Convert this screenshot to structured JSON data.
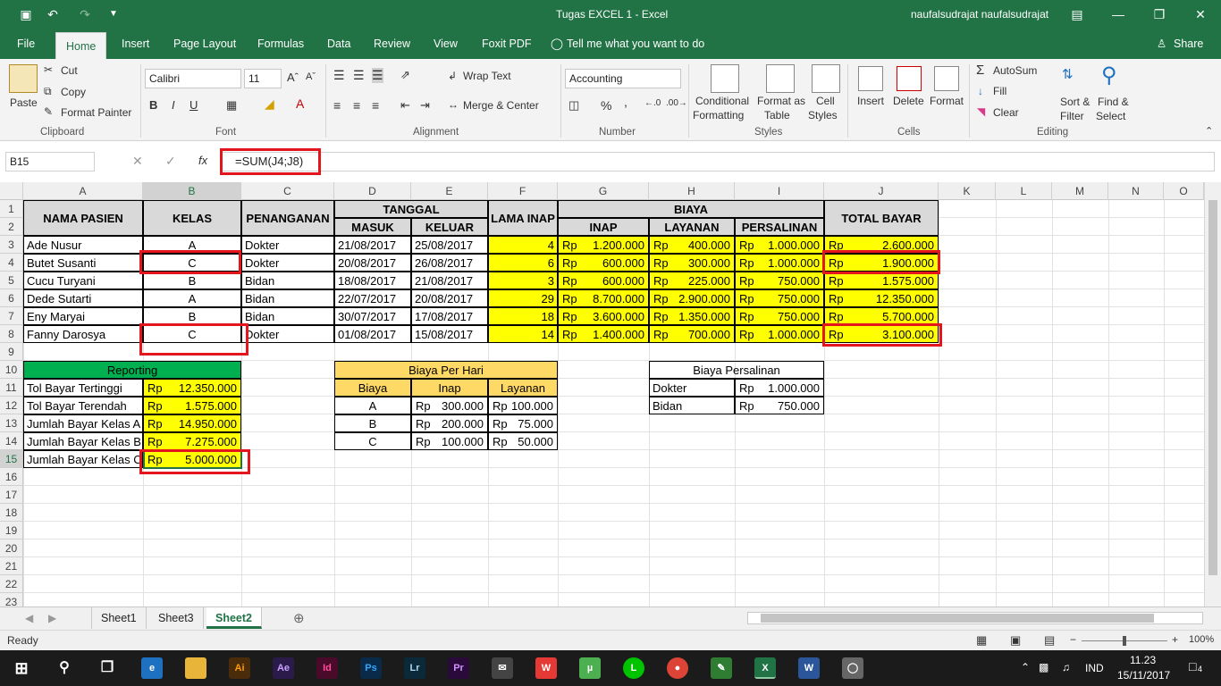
{
  "window": {
    "title": "Tugas EXCEL 1  -  Excel",
    "user": "naufalsudrajat naufalsudrajat"
  },
  "tabs": [
    "File",
    "Home",
    "Insert",
    "Page Layout",
    "Formulas",
    "Data",
    "Review",
    "View",
    "Foxit PDF"
  ],
  "tell_me": "Tell me what you want to do",
  "share": "Share",
  "ribbon": {
    "paste": "Paste",
    "cut": "Cut",
    "copy": "Copy",
    "format_painter": "Format Painter",
    "clipboard": "Clipboard",
    "font_name": "Calibri",
    "font_size": "11",
    "bold": "B",
    "italic": "I",
    "underline": "U",
    "font": "Font",
    "wrap_text": "Wrap Text",
    "merge_center": "Merge & Center",
    "alignment": "Alignment",
    "number_format": "Accounting",
    "percent": "%",
    "comma": ",",
    "number": "Number",
    "conditional": "Conditional",
    "formatting": "Formatting",
    "format_as": "Format as",
    "table": "Table",
    "cell": "Cell",
    "styles_btn": "Styles",
    "styles": "Styles",
    "insert": "Insert",
    "delete": "Delete",
    "format": "Format",
    "cells": "Cells",
    "autosum": "AutoSum",
    "fill": "Fill",
    "clear": "Clear",
    "sort_filter": "Sort &",
    "filter": "Filter",
    "find_select": "Find &",
    "select": "Select",
    "editing": "Editing"
  },
  "formula": {
    "namebox": "B15",
    "fx": "fx",
    "content": "=SUM(J4;J8)"
  },
  "columns": [
    "A",
    "B",
    "C",
    "D",
    "E",
    "F",
    "G",
    "H",
    "I",
    "J",
    "K",
    "L",
    "M",
    "N",
    "O"
  ],
  "rows": [
    "1",
    "2",
    "3",
    "4",
    "5",
    "6",
    "7",
    "8",
    "9",
    "10",
    "11",
    "12",
    "13",
    "14",
    "15",
    "16",
    "17",
    "18",
    "19",
    "20",
    "21",
    "22",
    "23"
  ],
  "headers": {
    "nama": "NAMA PASIEN",
    "kelas": "KELAS",
    "penanganan": "PENANGANAN",
    "tanggal": "TANGGAL",
    "masuk": "MASUK",
    "keluar": "KELUAR",
    "lama": "LAMA INAP",
    "biaya": "BIAYA",
    "inap": "INAP",
    "layanan": "LAYANAN",
    "persalinan": "PERSALINAN",
    "total": "TOTAL BAYAR"
  },
  "rp": "Rp",
  "patients": [
    {
      "nama": "Ade Nusur",
      "kelas": "A",
      "pen": "Dokter",
      "masuk": "21/08/2017",
      "keluar": "25/08/2017",
      "lama": "4",
      "inap": "1.200.000",
      "layanan": "400.000",
      "persalinan": "1.000.000",
      "total": "2.600.000"
    },
    {
      "nama": "Butet Susanti",
      "kelas": "C",
      "pen": "Dokter",
      "masuk": "20/08/2017",
      "keluar": "26/08/2017",
      "lama": "6",
      "inap": "600.000",
      "layanan": "300.000",
      "persalinan": "1.000.000",
      "total": "1.900.000"
    },
    {
      "nama": "Cucu Turyani",
      "kelas": "B",
      "pen": "Bidan",
      "masuk": "18/08/2017",
      "keluar": "21/08/2017",
      "lama": "3",
      "inap": "600.000",
      "layanan": "225.000",
      "persalinan": "750.000",
      "total": "1.575.000"
    },
    {
      "nama": "Dede Sutarti",
      "kelas": "A",
      "pen": "Bidan",
      "masuk": "22/07/2017",
      "keluar": "20/08/2017",
      "lama": "29",
      "inap": "8.700.000",
      "layanan": "2.900.000",
      "persalinan": "750.000",
      "total": "12.350.000"
    },
    {
      "nama": "Eny Maryai",
      "kelas": "B",
      "pen": "Bidan",
      "masuk": "30/07/2017",
      "keluar": "17/08/2017",
      "lama": "18",
      "inap": "3.600.000",
      "layanan": "1.350.000",
      "persalinan": "750.000",
      "total": "5.700.000"
    },
    {
      "nama": "Fanny Darosya",
      "kelas": "C",
      "pen": "Dokter",
      "masuk": "01/08/2017",
      "keluar": "15/08/2017",
      "lama": "14",
      "inap": "1.400.000",
      "layanan": "700.000",
      "persalinan": "1.000.000",
      "total": "3.100.000"
    }
  ],
  "reporting": {
    "title": "Reporting",
    "items": [
      {
        "label": "Tol Bayar Tertinggi",
        "value": "12.350.000"
      },
      {
        "label": "Tol Bayar Terendah",
        "value": "1.575.000"
      },
      {
        "label": "Jumlah Bayar Kelas A",
        "value": "14.950.000"
      },
      {
        "label": "Jumlah Bayar Kelas B",
        "value": "7.275.000"
      },
      {
        "label": "Jumlah Bayar Kelas C",
        "value": "5.000.000"
      }
    ]
  },
  "biaya_hari": {
    "title": "Biaya Per Hari",
    "cols": [
      "Biaya",
      "Inap",
      "Layanan"
    ],
    "rows": [
      {
        "k": "A",
        "inap": "300.000",
        "lay": "100.000"
      },
      {
        "k": "B",
        "inap": "200.000",
        "lay": "75.000"
      },
      {
        "k": "C",
        "inap": "100.000",
        "lay": "50.000"
      }
    ]
  },
  "biaya_persalinan": {
    "title": "Biaya Persalinan",
    "rows": [
      {
        "k": "Dokter",
        "v": "1.000.000"
      },
      {
        "k": "Bidan",
        "v": "750.000"
      }
    ]
  },
  "sheets": [
    "Sheet1",
    "Sheet3",
    "Sheet2"
  ],
  "status": {
    "ready": "Ready",
    "zoom": "100%"
  },
  "taskbar": {
    "lang": "IND",
    "time": "11.23",
    "date": "15/11/2017",
    "notif": "4"
  },
  "colors": {
    "excel_green": "#217346",
    "highlight_red": "#e2161c",
    "yellow": "#ffff00"
  }
}
